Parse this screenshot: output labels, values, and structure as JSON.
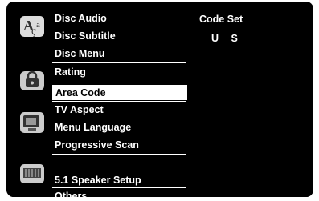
{
  "menu": {
    "items": [
      {
        "label": "Disc Audio"
      },
      {
        "label": "Disc Subtitle"
      },
      {
        "label": "Disc Menu"
      },
      {
        "label": "Rating"
      },
      {
        "label": "Area Code"
      },
      {
        "label": "TV Aspect"
      },
      {
        "label": "Menu Language"
      },
      {
        "label": "Progressive Scan"
      },
      {
        "label": "5.1 Speaker Setup"
      },
      {
        "label": "Others"
      }
    ],
    "selected_index": 4
  },
  "detail": {
    "title": "Code Set",
    "value": "U S"
  },
  "icons": [
    "language-icon",
    "lock-icon",
    "tv-icon",
    "speaker-icon"
  ]
}
